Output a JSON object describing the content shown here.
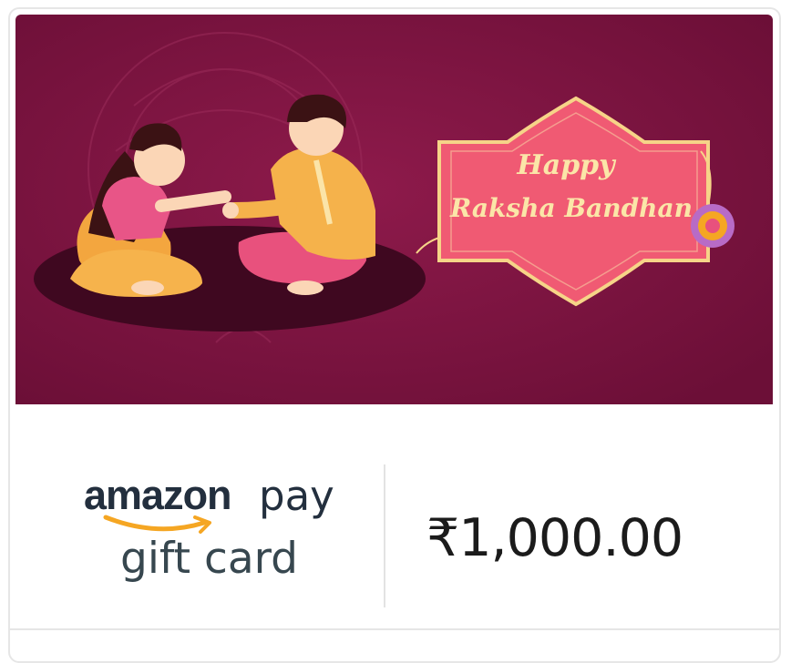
{
  "banner": {
    "greeting_line1": "Happy",
    "greeting_line2": "Raksha Bandhan",
    "colors": {
      "background": "#7d1340",
      "tag": "#f05a73",
      "tag_border": "#f6d488"
    }
  },
  "brand": {
    "amazon": "amazon",
    "pay": "pay",
    "gift_card": "gift card",
    "smile_color": "#f5a623"
  },
  "amount": "₹1,000.00"
}
